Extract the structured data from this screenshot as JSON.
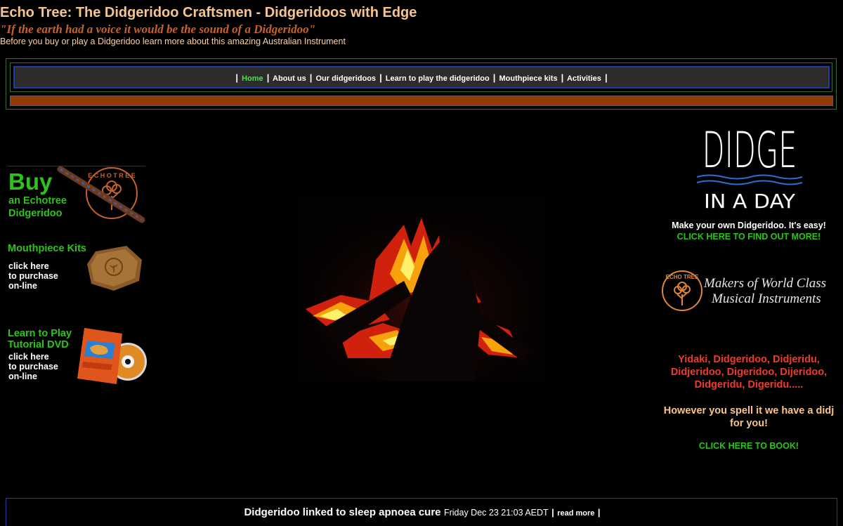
{
  "header": {
    "title": "Echo Tree: The Didgeridoo Craftsmen - Didgeridoos with Edge",
    "tagline": "\"If the earth had a voice it would be the sound of a Didgeridoo\"",
    "subline": "Before you buy or play a Didgeridoo learn more about this amazing Australian Instrument"
  },
  "nav": {
    "items": [
      {
        "label": "Home",
        "active": true
      },
      {
        "label": "About us"
      },
      {
        "label": "Our didgeridoos"
      },
      {
        "label": "Learn to play the didgeridoo"
      },
      {
        "label": "Mouthpiece kits"
      },
      {
        "label": "Activities"
      }
    ]
  },
  "colors": {
    "title": "#f8c48a",
    "tagline": "#c8622a",
    "green": "#2cc41a",
    "red": "#f03a2a",
    "orange_bar": "#933a05",
    "nav_border": "#1f3fa0"
  },
  "left": {
    "buy": {
      "big": "Buy",
      "line1": "an Echotree",
      "line2": "Didgeridoo",
      "logo_text": "ECHO TREE"
    },
    "mouthpiece": {
      "title": "Mouthpiece Kits",
      "lines": [
        "click here",
        "to purchase",
        "on-line"
      ]
    },
    "dvd": {
      "title1": "Learn to Play",
      "title2": "Tutorial DVD",
      "lines": [
        "click here",
        "to purchase",
        "on-line"
      ]
    }
  },
  "right": {
    "didge_logo": {
      "top_word": "DIDGE",
      "bottom_word": "IN A DAY"
    },
    "make_own": "Make your own Didgeridoo. It's easy!",
    "find_out": "CLICK HERE TO FIND OUT MORE!",
    "makers": {
      "line1": "Makers of World Class",
      "line2": "Musical Instruments",
      "seal_text": "ECHO TREE"
    },
    "spellings": "Yidaki, Didgeridoo, Didjeridu, Didjeridoo, Digeridoo, Dijeridoo, Didgeridu, Digeridu.....",
    "spell_msg": "However you spell it we have a didj for you!",
    "book": "CLICK HERE TO BOOK!"
  },
  "news": {
    "title": "Didgeridoo linked to sleep apnoea cure",
    "date": "Friday Dec 23 21:03 AEDT",
    "read_more": "read more"
  }
}
